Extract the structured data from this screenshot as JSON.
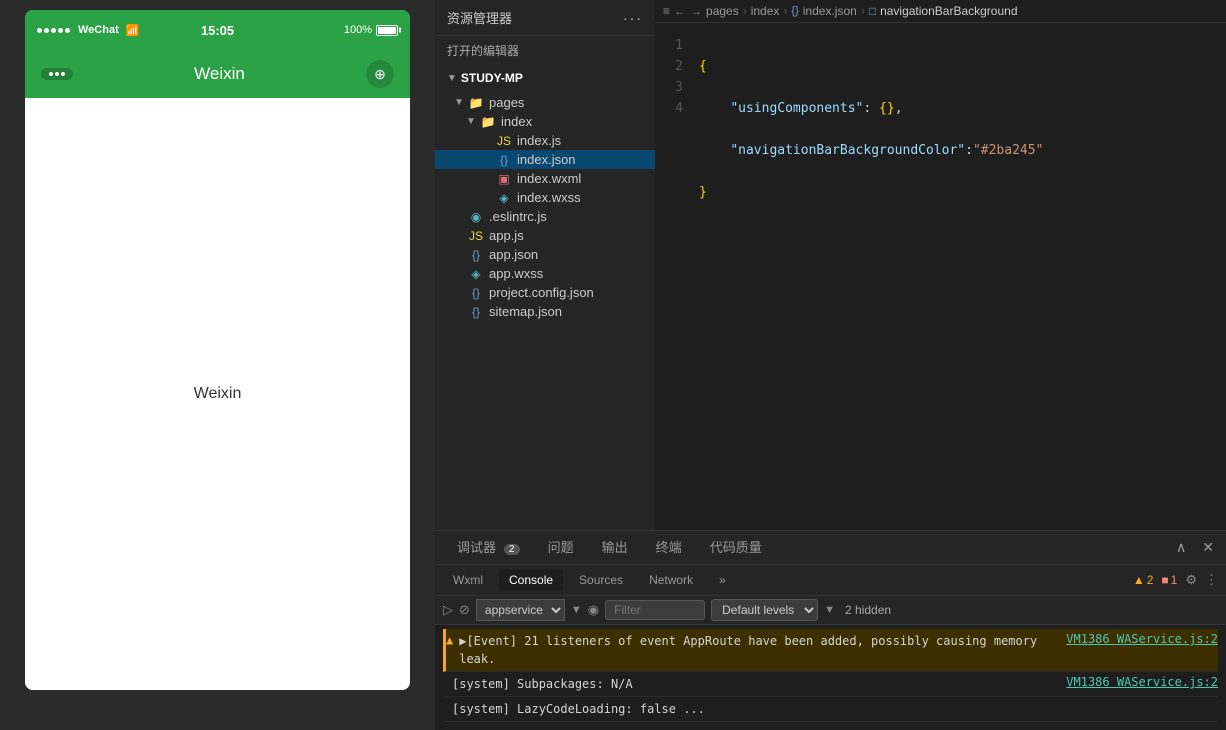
{
  "phone": {
    "status_bar": {
      "signal": "●●●●●",
      "carrier": "WeChat",
      "wifi": "▼",
      "time": "15:05",
      "battery_percent": "100%"
    },
    "nav": {
      "title": "Weixin",
      "dots_label": "•••"
    },
    "content": {
      "text": "Weixin"
    }
  },
  "explorer": {
    "header_title": "资源管理器",
    "menu_icon": "···",
    "open_editors": "打开的编辑器",
    "project_name": "STUDY-MP",
    "tree": [
      {
        "id": "pages",
        "label": "pages",
        "type": "folder",
        "indent": 1,
        "expanded": true
      },
      {
        "id": "index_folder",
        "label": "index",
        "type": "folder",
        "indent": 2,
        "expanded": true
      },
      {
        "id": "index_js",
        "label": "index.js",
        "type": "js",
        "indent": 3
      },
      {
        "id": "index_json",
        "label": "index.json",
        "type": "json",
        "indent": 3,
        "selected": true
      },
      {
        "id": "index_wxml",
        "label": "index.wxml",
        "type": "wxml",
        "indent": 3
      },
      {
        "id": "index_wxss",
        "label": "index.wxss",
        "type": "wxss",
        "indent": 3
      },
      {
        "id": "eslintrc",
        "label": ".eslintrc.js",
        "type": "eslint",
        "indent": 1
      },
      {
        "id": "app_js",
        "label": "app.js",
        "type": "js",
        "indent": 1
      },
      {
        "id": "app_json",
        "label": "app.json",
        "type": "json",
        "indent": 1
      },
      {
        "id": "app_wxss",
        "label": "app.wxss",
        "type": "wxss",
        "indent": 1
      },
      {
        "id": "project_config",
        "label": "project.config.json",
        "type": "json",
        "indent": 1
      },
      {
        "id": "sitemap",
        "label": "sitemap.json",
        "type": "json",
        "indent": 1
      }
    ]
  },
  "editor": {
    "breadcrumbs": [
      "pages",
      "index",
      "{} index.json",
      "□ navigationBarBackground"
    ],
    "toolbar_icons": [
      "≡",
      "←",
      "→"
    ],
    "lines": [
      1,
      2,
      3,
      4
    ],
    "code": [
      {
        "line": 1,
        "content": "{"
      },
      {
        "line": 2,
        "content": "    \"usingComponents\": {},"
      },
      {
        "line": 3,
        "content": "    \"navigationBarBackgroundColor\":\"#2ba245\""
      },
      {
        "line": 4,
        "content": "}"
      }
    ]
  },
  "bottom_panel": {
    "tabs": [
      {
        "label": "调试器",
        "badge": "2",
        "active": false
      },
      {
        "label": "问题",
        "badge": null,
        "active": false
      },
      {
        "label": "输出",
        "badge": null,
        "active": false
      },
      {
        "label": "终端",
        "badge": null,
        "active": false
      },
      {
        "label": "代码质量",
        "badge": null,
        "active": false
      }
    ],
    "close_icon": "∧",
    "devtools_tabs": [
      {
        "label": "Wxml",
        "active": false
      },
      {
        "label": "Console",
        "active": true
      },
      {
        "label": "Sources",
        "active": false
      },
      {
        "label": "Network",
        "active": false
      },
      {
        "label": "»",
        "active": false
      }
    ],
    "controls": {
      "block_icon": "⊘",
      "appservice_value": "appservice",
      "eye_icon": "◉",
      "filter_placeholder": "Filter",
      "levels_label": "Default levels",
      "hidden_count": "2 hidden"
    },
    "error_count": "1",
    "warning_count": "2",
    "console_lines": [
      {
        "type": "warning",
        "icon": "▲",
        "text": "▶[Event] 21 listeners of event AppRoute have been added, possibly causing memory leak.",
        "link": "VM1386 WAService.js:2"
      },
      {
        "type": "info",
        "icon": "",
        "text": "[system] Subpackages: N/A",
        "link": "VM1386 WAService.js:2"
      },
      {
        "type": "info",
        "icon": "",
        "text": "[system] LazyCodeLoading: false ...",
        "link": ""
      }
    ]
  }
}
